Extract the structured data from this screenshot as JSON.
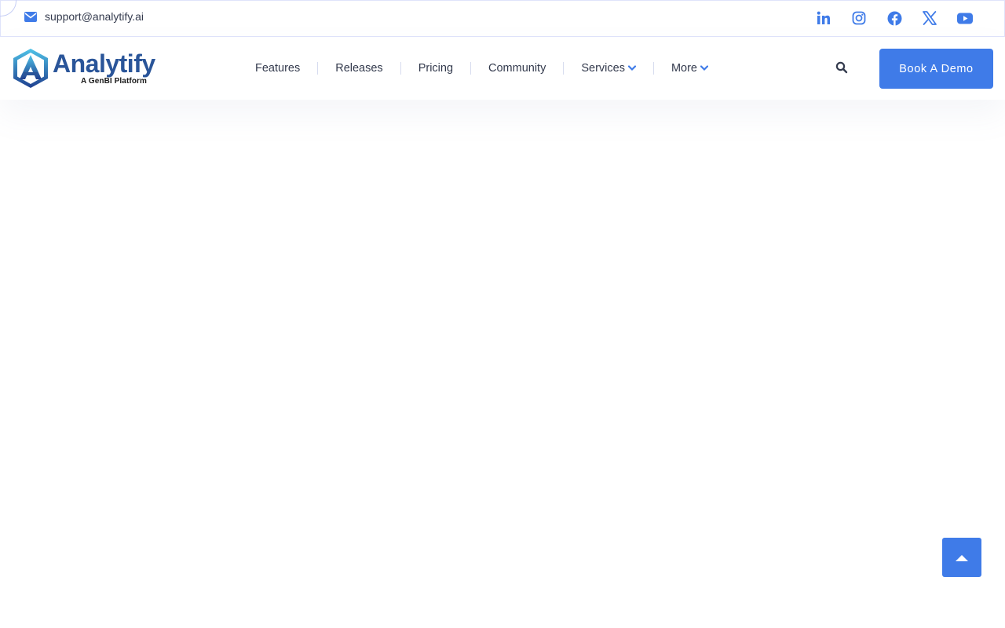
{
  "topbar": {
    "email": "support@analytify.ai",
    "email_icon": "envelope-icon",
    "socials": [
      {
        "name": "linkedin-icon"
      },
      {
        "name": "instagram-icon"
      },
      {
        "name": "facebook-icon"
      },
      {
        "name": "x-icon"
      },
      {
        "name": "youtube-icon"
      }
    ]
  },
  "logo": {
    "word": "Analytify",
    "tagline": "A GenBI Platform"
  },
  "nav": {
    "items": [
      {
        "label": "Features"
      },
      {
        "label": "Releases"
      },
      {
        "label": "Pricing"
      },
      {
        "label": "Community"
      },
      {
        "label": "Services",
        "dropdown": true
      },
      {
        "label": "More",
        "dropdown": true
      }
    ],
    "search_icon": "search-icon",
    "demo_label": "Book A Demo"
  },
  "scroll_top_icon": "caret-up-icon",
  "colors": {
    "accent": "#3f7be8",
    "text": "#333a4d",
    "logo_blue": "#2a5599"
  }
}
